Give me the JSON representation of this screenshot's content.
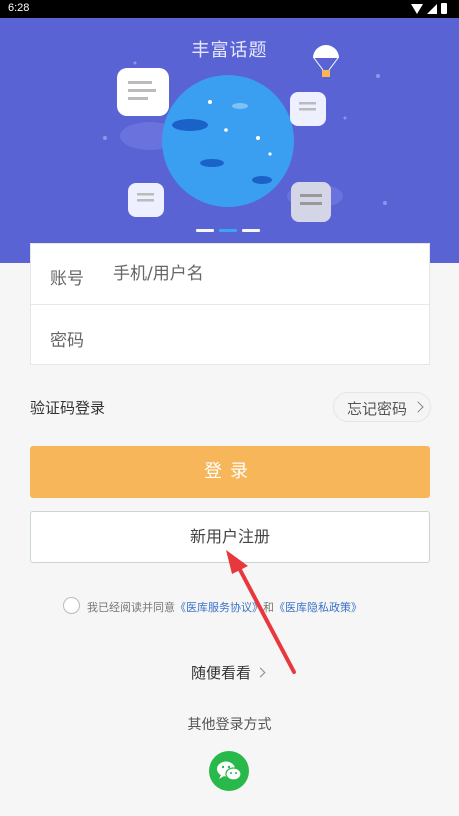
{
  "status_bar": {
    "time": "6:28"
  },
  "banner": {
    "title": "丰富话题",
    "page_count": 3,
    "active_page": 2
  },
  "form": {
    "account_label": "账号",
    "account_placeholder": "手机/用户名",
    "password_label": "密码",
    "password_placeholder": ""
  },
  "links": {
    "sms_login": "验证码登录",
    "forgot_password": "忘记密码"
  },
  "buttons": {
    "login": "登录",
    "register": "新用户注册"
  },
  "agreement": {
    "prefix": "我已经阅读并同意",
    "service_link": "《医库服务协议》",
    "and": "和",
    "privacy_link": "《医库隐私政策》",
    "checked": false
  },
  "browse": "随便看看",
  "other_login": {
    "title": "其他登录方式",
    "methods": [
      "wechat-icon"
    ]
  },
  "colors": {
    "banner": "#5a63d4",
    "login_button": "#f6b659",
    "link": "#3a72c8",
    "wechat": "#29b84a",
    "annotation_arrow": "#e8383d"
  }
}
